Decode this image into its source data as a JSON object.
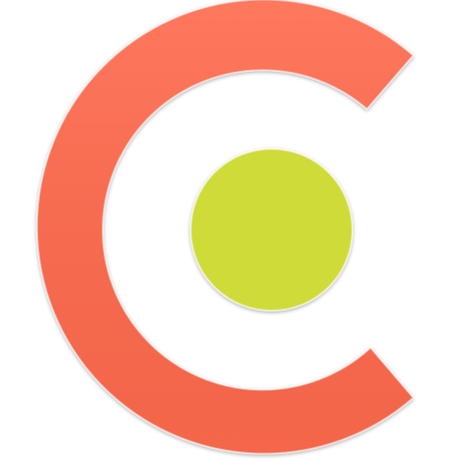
{
  "logo": {
    "icon": "c-with-dot-logo-icon",
    "colors": {
      "arc": "#FF6A4D",
      "dot": "#CFDB38",
      "background": "#FFFFFF"
    }
  }
}
